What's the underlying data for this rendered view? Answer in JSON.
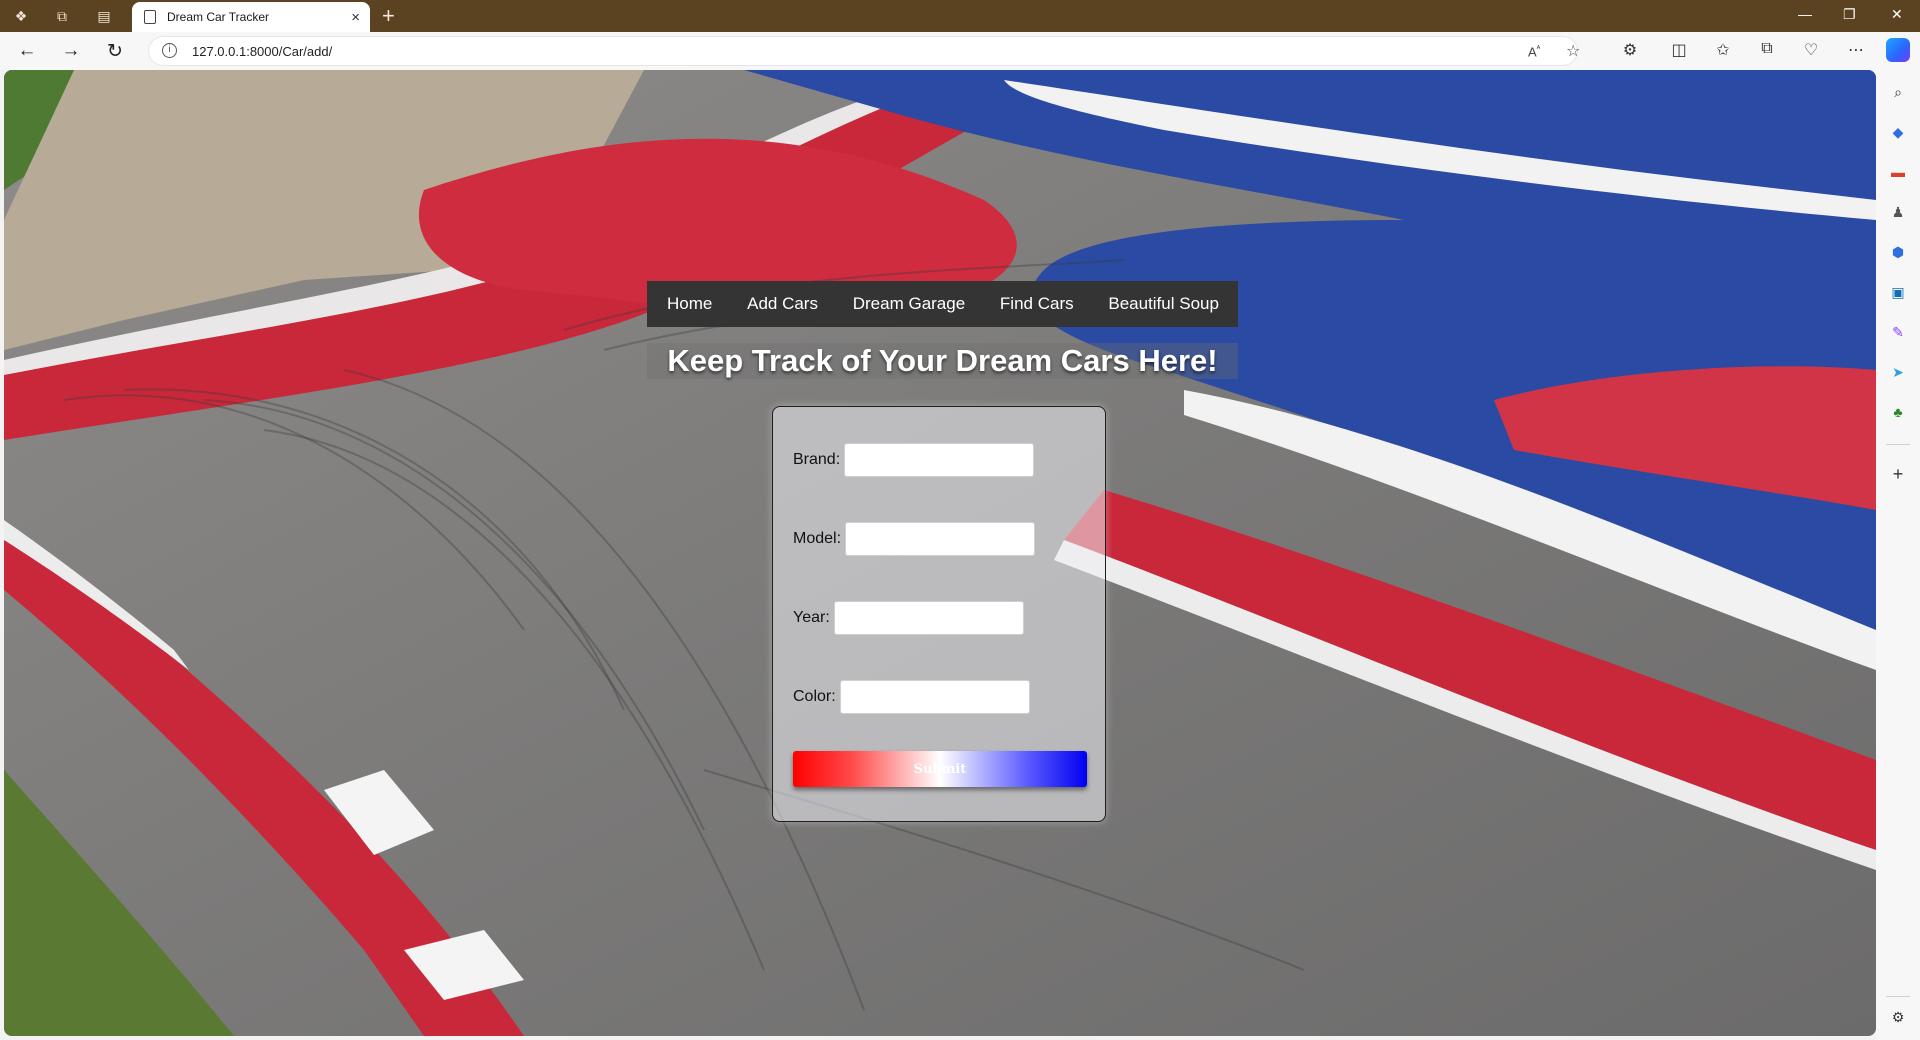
{
  "browser": {
    "tab_title": "Dream Car Tracker",
    "url": "127.0.0.1:8000/Car/add/",
    "new_tab_symbol": "+",
    "close_tab_symbol": "×"
  },
  "colors": {
    "titlebar": "#5b4322",
    "nav_background": "#343434",
    "submit_gradient_start": "#ff0000",
    "submit_gradient_end": "#0000f0"
  },
  "nav": {
    "items": [
      {
        "label": "Home"
      },
      {
        "label": "Add Cars"
      },
      {
        "label": "Dream Garage"
      },
      {
        "label": "Find Cars"
      },
      {
        "label": "Beautiful Soup"
      }
    ]
  },
  "page": {
    "heading": "Keep Track of Your Dream Cars Here!"
  },
  "form": {
    "brand_label": "Brand:",
    "brand_value": "",
    "model_label": "Model:",
    "model_value": "",
    "year_label": "Year:",
    "year_value": "",
    "color_label": "Color:",
    "color_value": "",
    "submit_label": "Submit"
  }
}
